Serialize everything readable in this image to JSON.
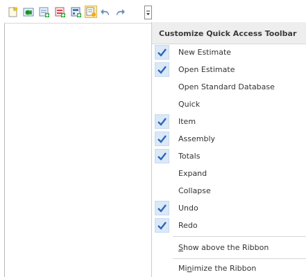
{
  "toolbar": {
    "buttons": [
      {
        "icon": "new-estimate-icon"
      },
      {
        "icon": "open-estimate-icon"
      },
      {
        "icon": "item-icon"
      },
      {
        "icon": "assembly-icon"
      },
      {
        "icon": "totals-icon"
      },
      {
        "icon": "quick-icon",
        "active": true
      },
      {
        "icon": "undo-icon"
      },
      {
        "icon": "redo-icon"
      }
    ],
    "dropdown_icon": "customize-dropdown-icon"
  },
  "menu": {
    "title": "Customize Quick Access Toolbar",
    "items": [
      {
        "label": "New Estimate",
        "checked": true
      },
      {
        "label": "Open Estimate",
        "checked": true
      },
      {
        "label": "Open Standard Database",
        "checked": false
      },
      {
        "label": "Quick",
        "checked": false
      },
      {
        "label": "Item",
        "checked": true
      },
      {
        "label": "Assembly",
        "checked": true
      },
      {
        "label": "Totals",
        "checked": true
      },
      {
        "label": "Expand",
        "checked": false
      },
      {
        "label": "Collapse",
        "checked": false
      },
      {
        "label": "Undo",
        "checked": true
      },
      {
        "label": "Redo",
        "checked": true
      }
    ],
    "show_above": {
      "pre": "",
      "mnemonic": "S",
      "post": "how above the Ribbon"
    },
    "minimize": {
      "pre": "Mi",
      "mnemonic": "n",
      "post": "imize the Ribbon"
    }
  },
  "colors": {
    "check": "#2a67b8",
    "check_bg": "#dbe8f7",
    "header_bg": "#eeeeee",
    "active_btn_bg": "#fde8a8"
  }
}
